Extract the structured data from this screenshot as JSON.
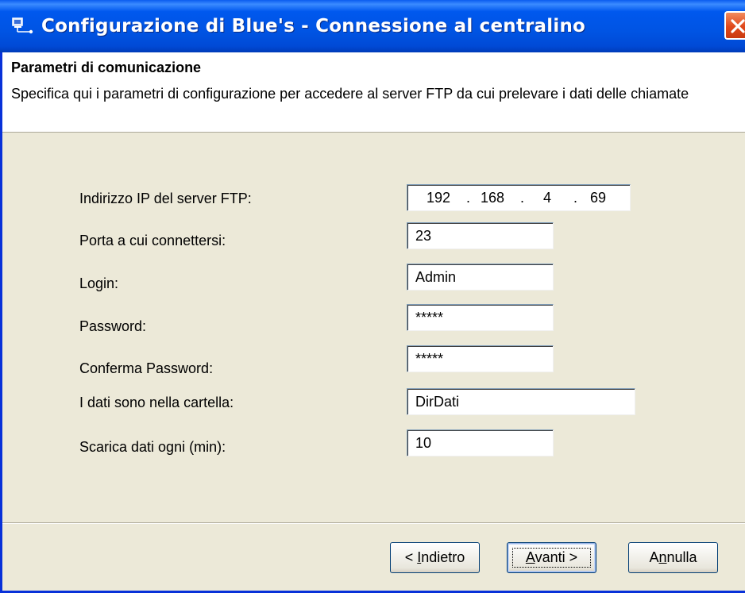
{
  "window": {
    "title": "Configurazione di Blue's - Connessione al centralino"
  },
  "header": {
    "title": "Parametri di comunicazione",
    "description": "Specifica qui i parametri di configurazione per accedere al server FTP da cui prelevare i dati delle chiamate"
  },
  "form": {
    "ip_label": "Indirizzo IP del server FTP:",
    "ip_octets": [
      "192",
      "168",
      "4",
      "69"
    ],
    "ip_separator": ".",
    "port_label": "Porta a cui connettersi:",
    "port_value": "23",
    "login_label": "Login:",
    "login_value": "Admin",
    "password_label": "Password:",
    "password_value": "*****",
    "confirm_password_label": "Conferma Password:",
    "confirm_password_value": "*****",
    "folder_label": "I dati sono nella cartella:",
    "folder_value": "DirDati",
    "interval_label": "Scarica dati ogni (min):",
    "interval_value": "10"
  },
  "buttons": {
    "back_prefix": "< ",
    "back_accel": "I",
    "back_rest": "ndietro",
    "next_accel": "A",
    "next_rest": "vanti >",
    "cancel_prefix": "A",
    "cancel_accel": "n",
    "cancel_rest": "nulla"
  },
  "icons": {
    "title_icon": "computer-network-icon",
    "close_icon": "close-icon"
  },
  "colors": {
    "titlebar": "#0054e3",
    "close_button": "#e0481b",
    "dialog_background": "#ece9d8"
  }
}
